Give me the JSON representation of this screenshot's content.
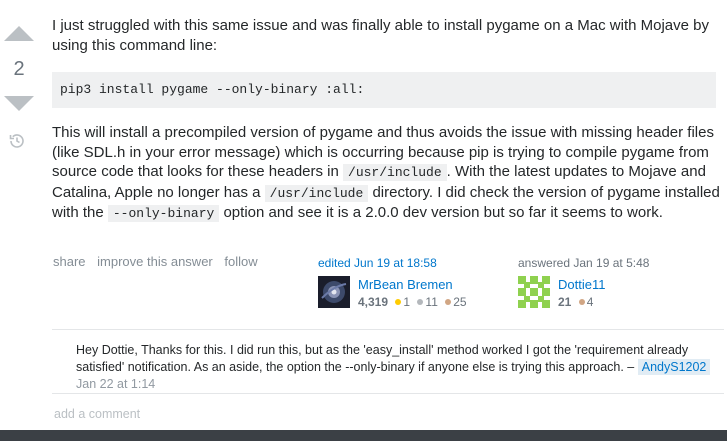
{
  "vote": {
    "count": "2"
  },
  "post": {
    "paragraph1": "I just struggled with this same issue and was finally able to install pygame on a Mac with Mojave by using this command line:",
    "code": "pip3 install pygame --only-binary :all:",
    "p2": {
      "t1": "This will install a precompiled version of pygame and thus avoids the issue with missing header files (like SDL.h in your error message) which is occurring because pip is trying to compile pygame from source code that looks for these headers in ",
      "c1": "/usr/include",
      "t2": ". With the latest updates to Mojave and Catalina, Apple no longer has a ",
      "c2": "/usr/include",
      "t3": " directory. I did check the version of pygame installed with the ",
      "c3": "--only-binary",
      "t4": " option and see it is a 2.0.0 dev version but so far it seems to work."
    }
  },
  "menu": {
    "share": "share",
    "improve": "improve this answer",
    "follow": "follow"
  },
  "editor": {
    "action": "edited Jun 19 at 18:58",
    "name": "MrBean Bremen",
    "reputation": "4,319",
    "gold": "1",
    "silver": "11",
    "bronze": "25"
  },
  "author": {
    "action": "answered Jan 19 at 5:48",
    "name": "Dottie11",
    "reputation": "21",
    "bronze": "4"
  },
  "comment": {
    "text": "Hey Dottie, Thanks for this. I did run this, but as the 'easy_install' method worked I got the 'requirement already satisfied' notification. As an aside, the option the --only-binary if anyone else is trying this approach. –",
    "user": "AndyS1202",
    "date": "Jan 22 at 1:14"
  },
  "add_comment": "add a comment",
  "colors": {
    "link": "#0077cc",
    "vote_arrow": "#bbc0c4",
    "code_bg": "#eff0f1",
    "bottom_bar": "#3b4045"
  },
  "icons": {
    "upvote": "upvote-arrow-icon",
    "downvote": "downvote-arrow-icon",
    "history": "history-icon"
  }
}
